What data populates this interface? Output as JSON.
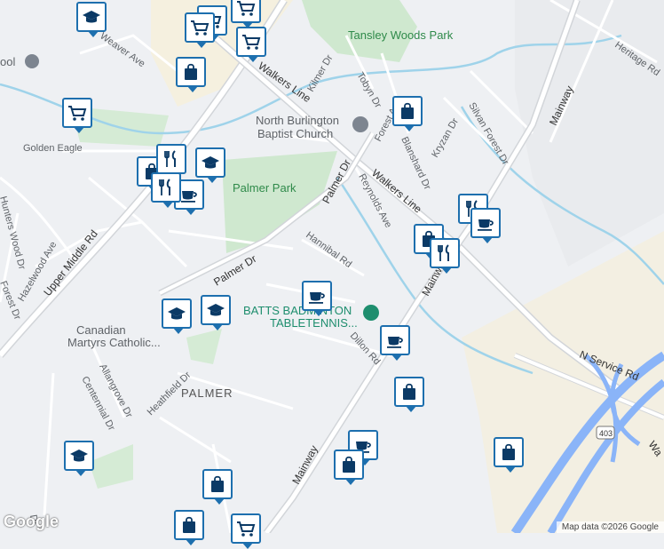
{
  "map": {
    "labels": {
      "tansley_woods_park": "Tansley Woods Park",
      "walkers_line_top": "Walkers Line",
      "kilmer_dr": "Kilmer Dr",
      "tobyn_dr": "Tobyn Dr",
      "forest_ave": "Forest Ave",
      "heritage_rd": "Heritage Rd",
      "mainway_top": "Mainway",
      "weaver_ave": "Weaver Ave",
      "school_fragment": "ool",
      "golden_eagle": "Golden Eagle",
      "north_burlington_1": "North Burlington",
      "north_burlington_2": "Baptist Church",
      "silvan_forest_dr": "Silvan Forest Dr",
      "kryzan_dr": "Kryzan Dr",
      "blanshard_dr": "Blanshard Dr",
      "palmer_park": "Palmer Park",
      "palmer_dr_upper": "Palmer Dr",
      "reynolds_ave": "Reynolds Ave",
      "walkers_line_mid": "Walkers Line",
      "hunters_wood_dr": "Hunters Wood Dr",
      "upper_middle_rd": "Upper Middle Rd",
      "hazelwood_ave": "Hazelwood Ave",
      "hannibal_rd": "Hannibal Rd",
      "palmer_dr_lower": "Palmer Dr",
      "forest_dr_left": "Forest Dr",
      "batts_1": "BATTS BADMINTON",
      "batts_2": "TABLETENNIS...",
      "canadian_1": "Canadian",
      "canadian_2": "Martyrs Catholic...",
      "mainway_mid": "Mainway",
      "dillon_rd": "Dillon Rd",
      "allangrove_dr": "Allangrove Dr",
      "centennial_dr": "Centennial Dr",
      "palmer_area": "PALMER",
      "heathfield_dr": "Heathfield Dr",
      "n_service_rd": "N Service Rd",
      "mainway_bottom": "Mainway",
      "hwy_403": "403",
      "walkers_edge": "Wa",
      "dr_fragment": "Dr"
    },
    "pins": [
      {
        "icon": "school-icon"
      },
      {
        "icon": "shopping-cart-icon"
      },
      {
        "icon": "shopping-cart-icon"
      },
      {
        "icon": "shopping-cart-icon"
      },
      {
        "icon": "shopping-bag-icon"
      },
      {
        "icon": "shopping-cart-icon"
      },
      {
        "icon": "shopping-bag-icon"
      },
      {
        "icon": "shopping-cart-icon"
      },
      {
        "icon": "shopping-bag-icon"
      },
      {
        "icon": "school-icon"
      },
      {
        "icon": "fork-knife-icon"
      },
      {
        "icon": "coffee-icon"
      },
      {
        "icon": "fork-knife-icon"
      },
      {
        "icon": "fork-knife-icon"
      },
      {
        "icon": "shopping-bag-icon"
      },
      {
        "icon": "fork-knife-icon"
      },
      {
        "icon": "coffee-icon"
      },
      {
        "icon": "coffee-icon"
      },
      {
        "icon": "school-icon"
      },
      {
        "icon": "school-icon"
      },
      {
        "icon": "coffee-icon"
      },
      {
        "icon": "shopping-bag-icon"
      },
      {
        "icon": "school-icon"
      },
      {
        "icon": "coffee-icon"
      },
      {
        "icon": "shopping-bag-icon"
      },
      {
        "icon": "shopping-bag-icon"
      },
      {
        "icon": "shopping-bag-icon"
      },
      {
        "icon": "shopping-bag-icon"
      },
      {
        "icon": "shopping-cart-icon"
      }
    ],
    "attribution": "Map data ©2026 Google",
    "logo": "Google"
  }
}
